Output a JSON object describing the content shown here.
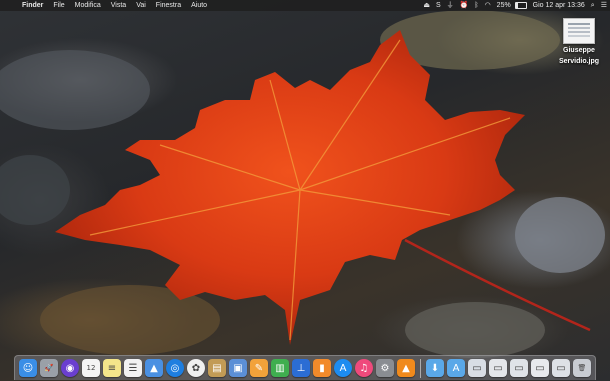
{
  "menubar": {
    "apple_icon": "apple-logo",
    "app_name": "Finder",
    "menus": [
      "File",
      "Modifica",
      "Vista",
      "Vai",
      "Finestra",
      "Aiuto"
    ],
    "status_icons": [
      "upload-icon",
      "skype-icon",
      "mic-off-icon",
      "alarm-icon",
      "bluetooth-icon",
      "wifi-icon"
    ],
    "battery_percent": "25%",
    "battery_level": 0.25,
    "datetime": "Gio 12 apr  13:36",
    "search_icon": "spotlight-icon",
    "notifications_icon": "notification-center-icon"
  },
  "desktop_file": {
    "line1": "Giuseppe",
    "line2": "Servidio.jpg"
  },
  "dock": {
    "apps": [
      {
        "name": "finder",
        "glyph": "☺",
        "color": "#3a8ee6"
      },
      {
        "name": "launchpad",
        "glyph": "🚀",
        "color": "#9aa0a8"
      },
      {
        "name": "siri",
        "glyph": "◉",
        "color": "#6a3fd0"
      },
      {
        "name": "calendar",
        "glyph": "12",
        "color": "#f4f4f4"
      },
      {
        "name": "notes",
        "glyph": "≡",
        "color": "#f4e58a"
      },
      {
        "name": "reminders",
        "glyph": "☰",
        "color": "#f2f2f2"
      },
      {
        "name": "keynote",
        "glyph": "▲",
        "color": "#4a90e2"
      },
      {
        "name": "safari",
        "glyph": "◎",
        "color": "#1e7ee0"
      },
      {
        "name": "photos",
        "glyph": "✿",
        "color": "#f0f0f0"
      },
      {
        "name": "notebook",
        "glyph": "▤",
        "color": "#c29b55"
      },
      {
        "name": "preview",
        "glyph": "▣",
        "color": "#5b8fd6"
      },
      {
        "name": "pages",
        "glyph": "✎",
        "color": "#f2a23a"
      },
      {
        "name": "numbers",
        "glyph": "▥",
        "color": "#3fae4f"
      },
      {
        "name": "keynote-present",
        "glyph": "⊥",
        "color": "#2b6dd4"
      },
      {
        "name": "books",
        "glyph": "▮",
        "color": "#f28a2a"
      },
      {
        "name": "app-store",
        "glyph": "A",
        "color": "#1d8cf0"
      },
      {
        "name": "itunes",
        "glyph": "♫",
        "color": "#ef4a7c"
      },
      {
        "name": "system-preferences",
        "glyph": "⚙",
        "color": "#8a8d92"
      },
      {
        "name": "vlc",
        "glyph": "▲",
        "color": "#f08a1c"
      }
    ],
    "folders": [
      {
        "name": "downloads-folder",
        "glyph": "⬇",
        "color": "#5aa8e8"
      },
      {
        "name": "applications-folder",
        "glyph": "A",
        "color": "#5aa8e8"
      },
      {
        "name": "screenshot-stack-1",
        "glyph": "▭",
        "color": "#d8dde4"
      },
      {
        "name": "screenshot-stack-2",
        "glyph": "▭",
        "color": "#e4e6ea"
      },
      {
        "name": "screenshot-stack-3",
        "glyph": "▭",
        "color": "#dfe3e8"
      },
      {
        "name": "screenshot-stack-4",
        "glyph": "▭",
        "color": "#e8eaed"
      },
      {
        "name": "screenshot-stack-5",
        "glyph": "▭",
        "color": "#dde1e6"
      },
      {
        "name": "trash",
        "glyph": "🗑",
        "color": "#c8ccd2"
      }
    ]
  }
}
